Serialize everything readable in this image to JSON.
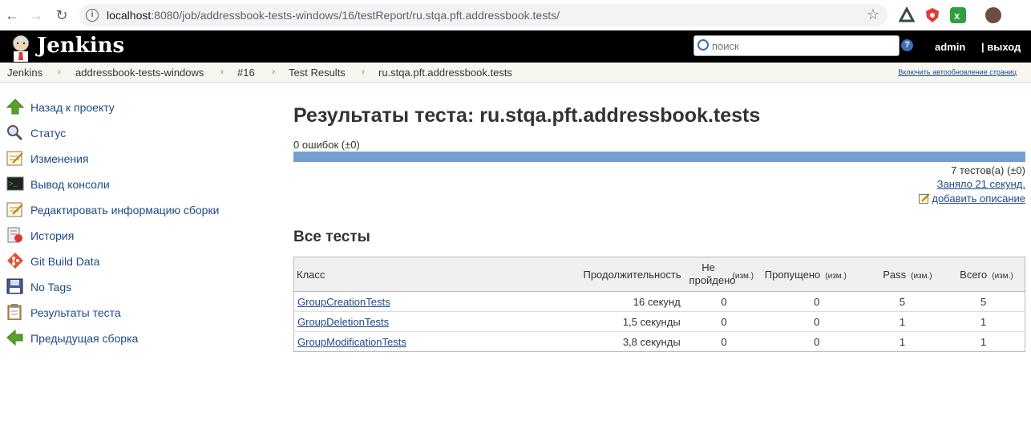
{
  "browser": {
    "url_host": "localhost",
    "url_path": ":8080/job/addressbook-tests-windows/16/testReport/ru.stqa.pft.addressbook.tests/"
  },
  "header": {
    "brand": "Jenkins",
    "search_placeholder": "поиск",
    "help": "?",
    "user": "admin",
    "logout": "| выход"
  },
  "breadcrumbs": {
    "items": [
      "Jenkins",
      "addressbook-tests-windows",
      "#16",
      "Test Results",
      "ru.stqa.pft.addressbook.tests"
    ],
    "autorefresh": "Включить автообновление страниц"
  },
  "sidebar": {
    "items": [
      {
        "label": "Назад к проекту",
        "icon": "up-arrow-icon"
      },
      {
        "label": "Статус",
        "icon": "magnifier-icon"
      },
      {
        "label": "Изменения",
        "icon": "notepad-icon"
      },
      {
        "label": "Вывод консоли",
        "icon": "terminal-icon"
      },
      {
        "label": "Редактировать информацию сборки",
        "icon": "notepad-icon"
      },
      {
        "label": "История",
        "icon": "history-icon"
      },
      {
        "label": "Git Build Data",
        "icon": "git-icon"
      },
      {
        "label": "No Tags",
        "icon": "save-icon"
      },
      {
        "label": "Результаты теста",
        "icon": "clipboard-icon"
      },
      {
        "label": "Предыдущая сборка",
        "icon": "left-arrow-icon"
      }
    ]
  },
  "main": {
    "title": "Результаты теста: ru.stqa.pft.addressbook.tests",
    "failures": "0 ошибок (±0)",
    "bar_color": "#729fcf",
    "tests_count": "7 тестов(а) (±0)",
    "took": "Заняло 21 секунд.",
    "add_description": "добавить описание",
    "all_tests_heading": "Все тесты",
    "table": {
      "headers": {
        "class": "Класс",
        "duration": "Продолжительность",
        "failed": "Не пройдено",
        "failed_diff": "(изм.)",
        "skipped": "Пропущено",
        "skipped_diff": "(изм.)",
        "pass": "Pass",
        "pass_diff": "(изм.)",
        "total": "Всего",
        "total_diff": "(изм.)"
      },
      "rows": [
        {
          "class": "GroupCreationTests",
          "duration": "16 секунд",
          "failed": "0",
          "skipped": "0",
          "pass": "5",
          "total": "5"
        },
        {
          "class": "GroupDeletionTests",
          "duration": "1,5 секунды",
          "failed": "0",
          "skipped": "0",
          "pass": "1",
          "total": "1"
        },
        {
          "class": "GroupModificationTests",
          "duration": "3,8 секунды",
          "failed": "0",
          "skipped": "0",
          "pass": "1",
          "total": "1"
        }
      ]
    }
  }
}
